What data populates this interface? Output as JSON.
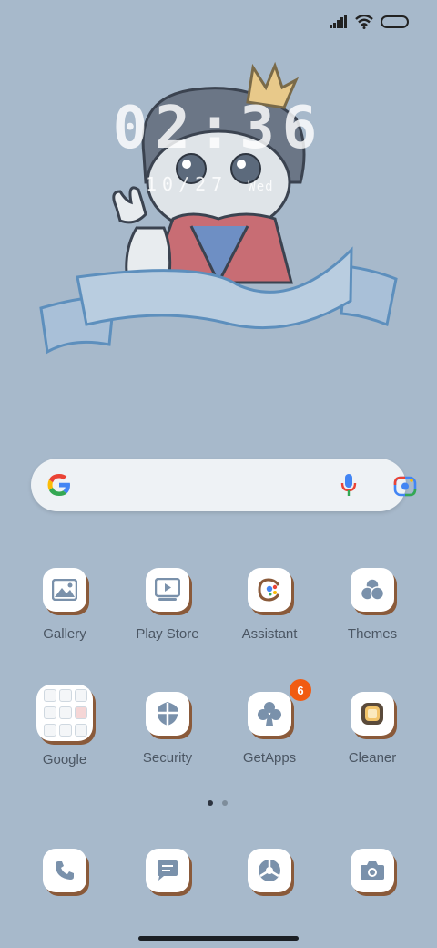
{
  "status_bar": {
    "signal_icon": "signal-icon",
    "wifi_icon": "wifi-icon",
    "battery_icon": "battery-icon"
  },
  "clock": {
    "time": "02:36",
    "date": "10/27",
    "day": "Wed"
  },
  "search_bar": {
    "logo": "google-g-icon",
    "mic_icon": "microphone-icon",
    "lens_icon": "google-lens-icon"
  },
  "apps": [
    {
      "label": "Gallery",
      "icon": "gallery-icon"
    },
    {
      "label": "Play Store",
      "icon": "play-store-icon"
    },
    {
      "label": "Assistant",
      "icon": "assistant-icon"
    },
    {
      "label": "Themes",
      "icon": "themes-icon"
    },
    {
      "label": "Google",
      "icon": "google-folder-icon"
    },
    {
      "label": "Security",
      "icon": "security-icon"
    },
    {
      "label": "GetApps",
      "icon": "getapps-icon",
      "badge": "6"
    },
    {
      "label": "Cleaner",
      "icon": "cleaner-icon"
    }
  ],
  "page_indicator": {
    "pages": 2,
    "current": 1
  },
  "dock": [
    {
      "icon": "phone-icon"
    },
    {
      "icon": "messages-icon"
    },
    {
      "icon": "browser-icon"
    },
    {
      "icon": "camera-icon"
    }
  ],
  "colors": {
    "background": "#a7b9cb",
    "badge": "#f15b11",
    "icon_glyph": "#7a91ab"
  }
}
